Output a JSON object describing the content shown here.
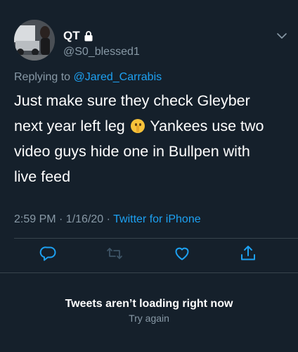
{
  "author": {
    "display_name": "QT",
    "handle": "@S0_blessed1",
    "protected_icon": "lock-icon"
  },
  "reply": {
    "prefix": "Replying to ",
    "mention": "@Jared_Carrabis"
  },
  "body": {
    "line1": "Just make sure they check Gleyber",
    "line2_before": "next year left leg ",
    "emoji": "shushing-face-emoji",
    "line2_after": " Yankees use two",
    "line3": "video guys hide one in Bullpen with",
    "line4": "live feed"
  },
  "meta": {
    "timestamp": "2:59 PM · 1/16/20 · ",
    "source": "Twitter for iPhone"
  },
  "actions": {
    "reply_icon": "reply-icon",
    "retweet_icon": "retweet-icon",
    "like_icon": "heart-icon",
    "share_icon": "share-icon"
  },
  "error": {
    "title": "Tweets aren’t loading right now",
    "retry": "Try again"
  },
  "colors": {
    "background": "#15202b",
    "accent": "#1da1f2",
    "secondary_text": "#8899a6",
    "divider": "#38444d"
  }
}
